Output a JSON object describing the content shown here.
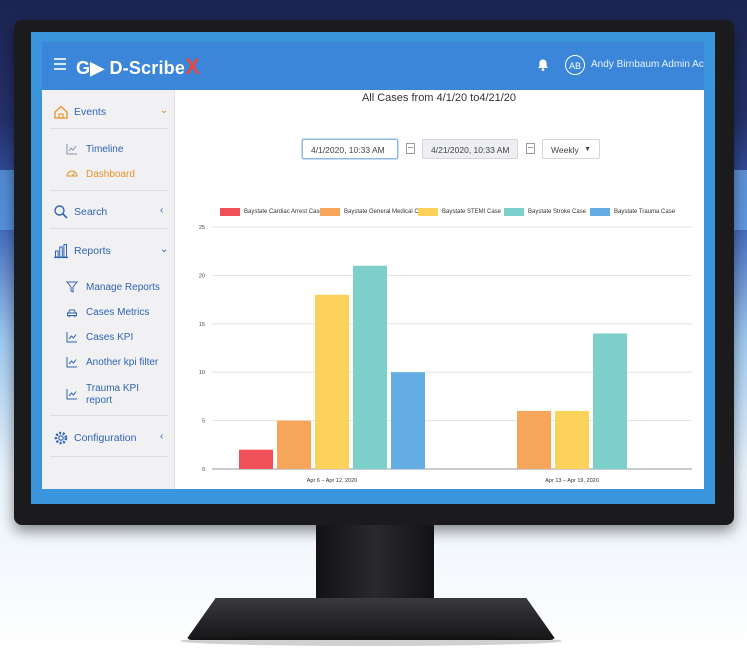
{
  "header": {
    "logo_main": "G▶ D-Scribe",
    "logo_x": "X",
    "avatar_initials": "AB",
    "user_name": "Andy Birnbaum Admin Account"
  },
  "sidebar": {
    "events": {
      "label": "Events",
      "icon": "home-icon"
    },
    "timeline": {
      "label": "Timeline",
      "icon": "timeline-icon"
    },
    "dashboard": {
      "label": "Dashboard",
      "icon": "dashboard-icon"
    },
    "search": {
      "label": "Search",
      "icon": "search-icon"
    },
    "reports": {
      "label": "Reports",
      "icon": "bar-chart-icon"
    },
    "manage_reports": {
      "label": "Manage Reports",
      "icon": "filter-icon"
    },
    "cases_metrics": {
      "label": "Cases Metrics",
      "icon": "car-icon"
    },
    "cases_kpi": {
      "label": "Cases KPI",
      "icon": "trend-icon"
    },
    "another_kpi": {
      "label": "Another kpi filter",
      "icon": "trend-icon"
    },
    "trauma_kpi_1": "Trauma KPI",
    "trauma_kpi_2": "report",
    "configuration": {
      "label": "Configuration",
      "icon": "gear-icon"
    }
  },
  "filters": {
    "start_date": "4/1/2020, 10:33 AM",
    "end_date": "4/21/2020, 10:33 AM",
    "interval": "Weekly"
  },
  "colors": {
    "topbar": "#3b86d9",
    "frame": "#3a95dc",
    "accent_orange": "#e69429"
  },
  "chart_data": {
    "type": "bar",
    "title": "All Cases from 4/1/20 to4/21/20",
    "categories": [
      "Apr 6 – Apr 12, 2020",
      "Apr 13 – Apr 19, 2020"
    ],
    "series": [
      {
        "name": "Baystate Cardiac Arrest Case",
        "color": "#f0505a",
        "values": [
          2,
          0
        ]
      },
      {
        "name": "Baystate General Medical Case",
        "color": "#f5a65b",
        "values": [
          5,
          6
        ]
      },
      {
        "name": "Baystate STEMI Case",
        "color": "#fcd25a",
        "values": [
          18,
          6
        ]
      },
      {
        "name": "Baystate Stroke Case",
        "color": "#7ccfca",
        "values": [
          21,
          14
        ]
      },
      {
        "name": "Baystate Trauma Case",
        "color": "#63ade4",
        "values": [
          10,
          0
        ]
      }
    ],
    "yticks": [
      0,
      5,
      10,
      15,
      20,
      25
    ],
    "ylim": [
      0,
      25
    ],
    "grid": true,
    "legend_position": "top"
  }
}
